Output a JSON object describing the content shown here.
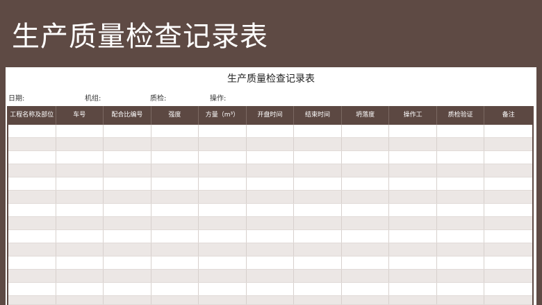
{
  "banner": {
    "title": "生产质量检查记录表"
  },
  "sheet": {
    "title": "生产质量检查记录表",
    "fields": [
      {
        "label": "日期:"
      },
      {
        "label": "机组:"
      },
      {
        "label": "质检:"
      },
      {
        "label": "操作:"
      }
    ],
    "columns": [
      "工程名称及部位",
      "车号",
      "配合比编号",
      "强度",
      "方量（m³）",
      "开盘时间",
      "结束时间",
      "坍落度",
      "操作工",
      "质检验证",
      "备注"
    ]
  },
  "colors": {
    "brand": "#5e4a44",
    "header_bg": "#5c4842",
    "row_alt": "#ece7e5"
  }
}
